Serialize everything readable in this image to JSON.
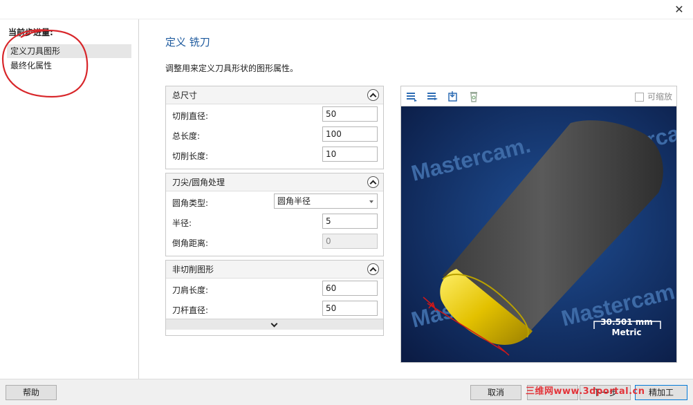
{
  "window": {
    "close_label": "✕"
  },
  "sidebar": {
    "heading": "当前步进量:",
    "items": [
      {
        "label": "定义刀具图形",
        "active": true
      },
      {
        "label": "最终化属性",
        "active": false
      }
    ]
  },
  "main": {
    "title": "定义 铣刀",
    "description": "调整用来定义刀具形状的图形属性。"
  },
  "groups": {
    "overall": {
      "title": "总尺寸",
      "cutting_diameter": {
        "label": "切削直径:",
        "value": "50"
      },
      "overall_length": {
        "label": "总长度:",
        "value": "100"
      },
      "cutting_length": {
        "label": "切削长度:",
        "value": "10"
      }
    },
    "tip": {
      "title": "刀尖/圆角处理",
      "corner_type": {
        "label": "圆角类型:",
        "value": "圆角半径"
      },
      "radius": {
        "label": "半径:",
        "value": "5"
      },
      "chamfer": {
        "label": "倒角距离:",
        "value": "0"
      }
    },
    "noncutting": {
      "title": "非切削图形",
      "shoulder_length": {
        "label": "刀肩长度:",
        "value": "60"
      },
      "shank_diameter": {
        "label": "刀杆直径:",
        "value": "50"
      }
    }
  },
  "preview": {
    "zoom_label": "可缩放",
    "watermark_text": "Mastercam.",
    "scale_value": "30.501 mm",
    "scale_unit": "Metric",
    "colors": {
      "bg_dark": "#0b1c45",
      "bg_light": "#1f4f95",
      "body": "#4a4a4a",
      "tip": "#e3c100",
      "dimension": "#d01818"
    }
  },
  "footer": {
    "help": "帮助",
    "cancel": "取消",
    "next": "下一步",
    "finish": "精加工",
    "site_watermark": "三维网www.3dportal.cn"
  }
}
